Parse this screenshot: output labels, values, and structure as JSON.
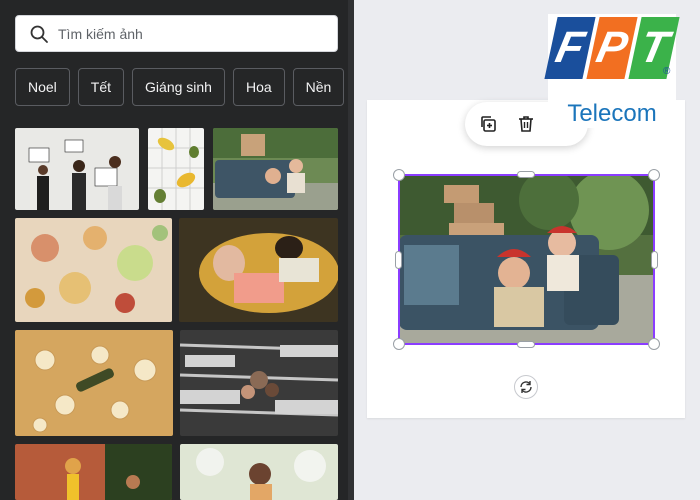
{
  "search": {
    "placeholder": "Tìm kiếm ảnh",
    "icon": "search-icon"
  },
  "categories": [
    "Noel",
    "Tết",
    "Giáng sinh",
    "Hoa",
    "Nền"
  ],
  "toolbar": {
    "icons": [
      "duplicate-icon",
      "trash-icon",
      "more-icon"
    ],
    "more_label": "···"
  },
  "logo": {
    "letters": [
      "F",
      "P",
      "T"
    ],
    "letter_colors": [
      "#1a4f9c",
      "#f26f21",
      "#3bb24a"
    ],
    "word": "Telecom",
    "reg": "®"
  },
  "colors": {
    "panel_bg": "#252627",
    "canvas_bg": "#ebecf0",
    "selection": "#8b3dff"
  }
}
